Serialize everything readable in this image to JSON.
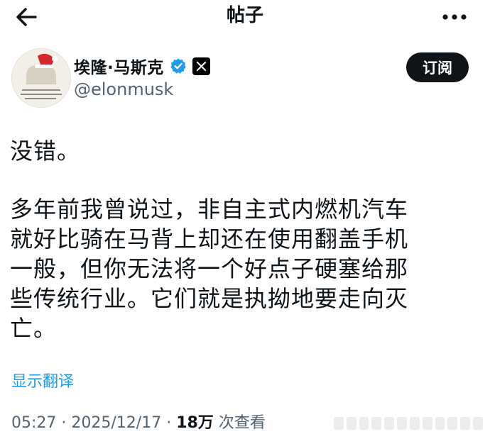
{
  "header": {
    "title": "帖子",
    "back_icon": "arrow-left-icon",
    "more_icon": "more-horizontal-icon"
  },
  "author": {
    "name": "埃隆·马斯克",
    "handle": "@elonmusk",
    "verified_icon": "verified-badge-icon",
    "badge_icon": "x-logo-icon",
    "badge_color": "#000000",
    "verified_color": "#1d9bf0"
  },
  "subscribe_button": {
    "label": "订阅"
  },
  "post": {
    "paragraph_1": "没错。",
    "paragraph_2": "多年前我曾说过，非自主式内燃机汽车\n就好比骑在马背上却还在使用翻盖手机\n一般，但你无法将一个好点子硬塞给那\n些传统行业。它们就是执拗地要走向灭\n亡。"
  },
  "translate_link": "显示翻译",
  "meta": {
    "time": "05:27",
    "date": "2025/12/17",
    "views_count": "18万",
    "views_label": "次查看"
  }
}
